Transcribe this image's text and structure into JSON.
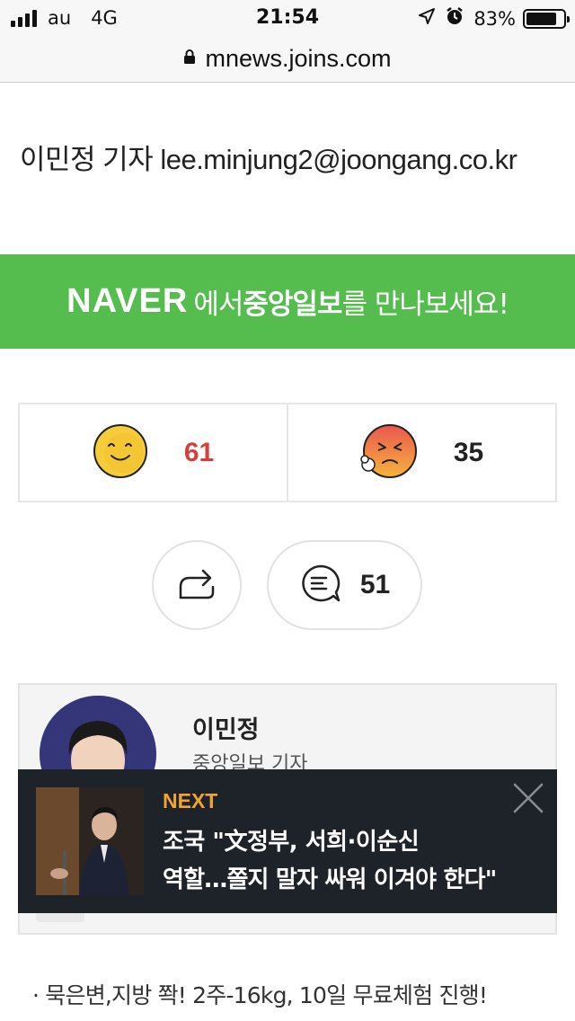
{
  "status_bar": {
    "carrier": "au",
    "network": "4G",
    "time": "21:54",
    "battery": "83%",
    "battery_level": 0.83
  },
  "url_bar": {
    "url": "mnews.joins.com"
  },
  "article": {
    "byline": "이민정 기자 lee.minjung2@joongang.co.kr"
  },
  "naver_banner": {
    "logo": "NAVER",
    "text_before": "에서 ",
    "brand": "중앙일보",
    "text_after": "를 만나보세요!",
    "color": "#54bd4e"
  },
  "reactions": {
    "like_count": "61",
    "angry_count": "35"
  },
  "actions": {
    "comment_count": "51"
  },
  "reporter": {
    "name": "이민정",
    "title": "중앙일보 기자"
  },
  "next_article": {
    "label": "NEXT",
    "line1": "조국 \"文정부, 서희·이순신",
    "line2": "역할…쫄지 말자 싸워 이겨야 한다\""
  },
  "ad": {
    "text": "· 묵은변,지방 쫙! 2주-16kg, 10일 무료체험 진행!"
  }
}
